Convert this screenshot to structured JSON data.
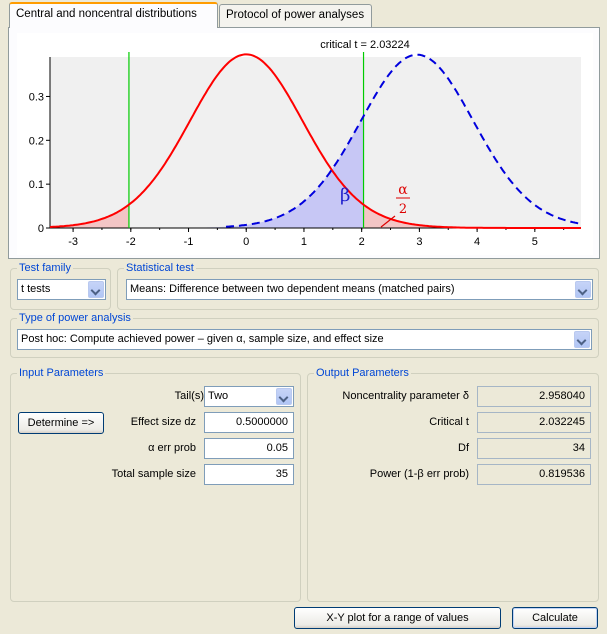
{
  "tabs": [
    {
      "label": "Central and noncentral distributions",
      "active": true
    },
    {
      "label": "Protocol of power analyses",
      "active": false
    }
  ],
  "chart_data": {
    "type": "line",
    "title": "critical t = 2.03224",
    "xlim": [
      -3.4,
      5.8
    ],
    "ylim": [
      0,
      0.39
    ],
    "x_ticks": [
      "-3",
      "-2",
      "-1",
      "0",
      "1",
      "2",
      "3",
      "4",
      "5"
    ],
    "y_ticks": [
      "0",
      "0.1",
      "0.2",
      "0.3"
    ],
    "critical_values": [
      -2.03224,
      2.03224
    ],
    "series": [
      {
        "style": "solid",
        "color": "#ff0000",
        "df": 34,
        "noncentrality": 0
      },
      {
        "style": "dashed",
        "color": "#0000dd",
        "df": 34,
        "noncentrality": 2.95804
      }
    ],
    "annotations": {
      "beta": "β",
      "alpha": "α",
      "alpha_divisor": "2"
    }
  },
  "test_family": {
    "title": "Test family",
    "value": "t tests"
  },
  "statistical_test": {
    "title": "Statistical test",
    "value": "Means: Difference between two dependent means (matched pairs)"
  },
  "power_analysis": {
    "title": "Type of power analysis",
    "value": "Post hoc: Compute achieved power – given α, sample size, and effect size"
  },
  "input": {
    "title": "Input Parameters",
    "tails_label": "Tail(s)",
    "tails_value": "Two",
    "determine_label": "Determine =>",
    "effect_label": "Effect size dz",
    "effect_value": "0.5000000",
    "alpha_label": "α err prob",
    "alpha_value": "0.05",
    "n_label": "Total sample size",
    "n_value": "35"
  },
  "output": {
    "title": "Output Parameters",
    "nc_label": "Noncentrality parameter δ",
    "nc_value": "2.958040",
    "crit_label": "Critical t",
    "crit_value": "2.032245",
    "df_label": "Df",
    "df_value": "34",
    "power_label": "Power (1-β err prob)",
    "power_value": "0.819536"
  },
  "buttons": {
    "xy_plot": "X-Y plot for a range of values",
    "calculate": "Calculate"
  }
}
